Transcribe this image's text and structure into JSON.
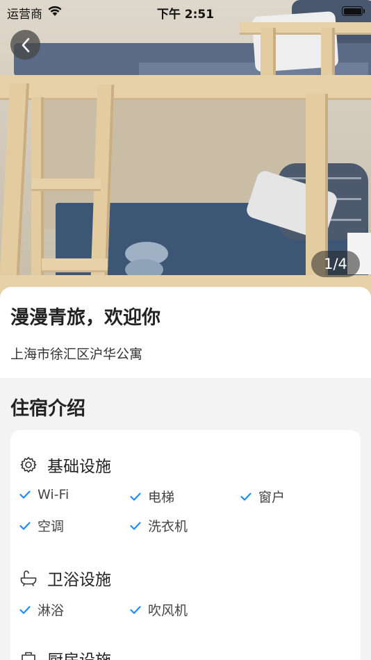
{
  "status_bar": {
    "carrier": "运营商",
    "time": "下午 2:51"
  },
  "gallery": {
    "counter": "1/4"
  },
  "listing": {
    "name": "漫漫青旅，欢迎你",
    "address": "上海市徐汇区沪华公寓"
  },
  "section": {
    "title": "住宿介绍"
  },
  "amenities": {
    "basic": {
      "title": "基础设施",
      "icon": "gear-icon",
      "items": [
        "Wi-Fi",
        "电梯",
        "窗户",
        "空调",
        "洗衣机"
      ]
    },
    "bath": {
      "title": "卫浴设施",
      "icon": "bathtub-icon",
      "items": [
        "淋浴",
        "吹风机"
      ]
    },
    "kitchen": {
      "title": "厨房设施",
      "icon": "pot-icon"
    }
  },
  "colors": {
    "check": "#1a8cff",
    "page_bg": "#f3f3f3"
  }
}
